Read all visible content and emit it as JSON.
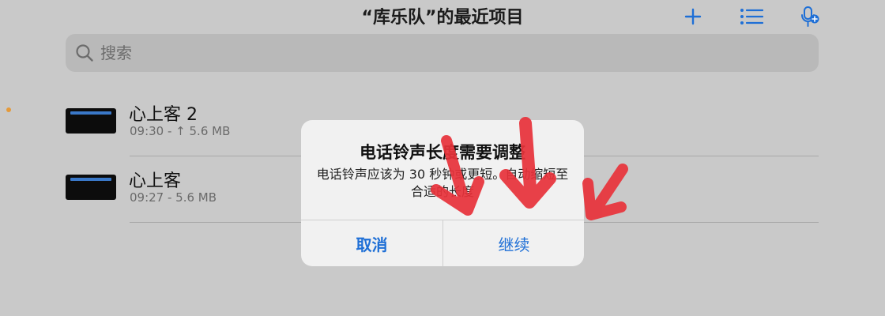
{
  "header": {
    "title": "“库乐队”的最近项目",
    "add_icon": "plus-icon",
    "list_icon": "list-icon",
    "mic_icon": "mic-add-icon"
  },
  "search": {
    "placeholder": "搜索"
  },
  "projects": [
    {
      "name": "心上客 2",
      "meta": "09:30 - ↑ 5.6 MB"
    },
    {
      "name": "心上客",
      "meta": "09:27 - 5.6 MB"
    }
  ],
  "alert": {
    "title": "电话铃声长度需要调整",
    "message": "电话铃声应该为 30 秒钟或更短。自动缩短至合适的长度",
    "cancel_label": "取消",
    "continue_label": "继续"
  },
  "colors": {
    "accent": "#1e6fd6",
    "annotation": "#e8323a",
    "background": "#c9c9c9"
  }
}
